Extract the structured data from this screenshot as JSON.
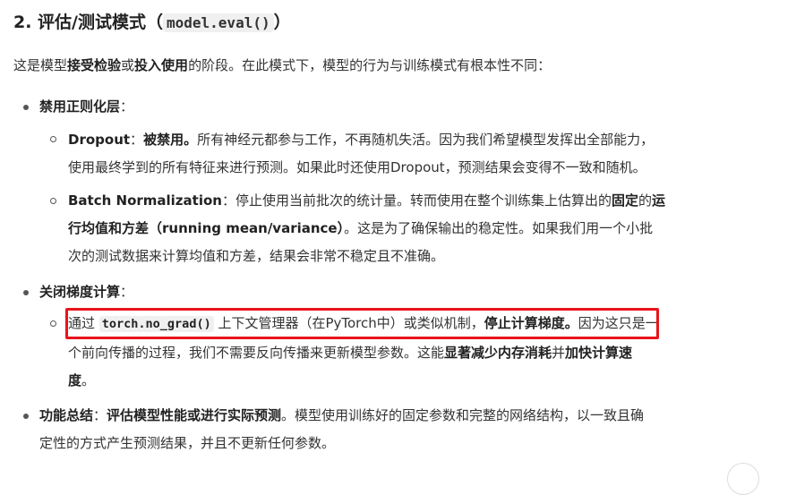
{
  "heading": {
    "prefix": "2. 评估/测试模式（",
    "code": "model.eval()",
    "suffix": "）"
  },
  "intro": {
    "t1": "这是模型",
    "b1": "接受检验",
    "t2": "或",
    "b2": "投入使用",
    "t3": "的阶段。在此模式下，模型的行为与训练模式有根本性不同："
  },
  "items": {
    "reg": {
      "label": "禁用正则化层",
      "colon": "："
    },
    "dropout": {
      "name": "Dropout",
      "t1": "：",
      "b1": "被禁用。",
      "t2": "所有神经元都参与工作，不再随机失活。因为我们希望模型发挥出全部能力，",
      "line2": "使用最终学到的所有特征来进行预测。如果此时还使用Dropout，预测结果会变得不一致和随机。"
    },
    "bn": {
      "name": "Batch Normalization",
      "t1": "：停止使用当前批次的统计量。转而使用在整个训练集上估算出的",
      "b1": "固定",
      "t2": "的",
      "b2": "运",
      "line2_b": "行均值和方差（running mean/variance）",
      "line2_t": "。这是为了确保输出的稳定性。如果我们用一个小批",
      "line3": "次的测试数据来计算均值和方差，结果会非常不稳定且不准确。"
    },
    "grad": {
      "label": "关闭梯度计算",
      "colon": "："
    },
    "nograd": {
      "t1": "通过 ",
      "code": "torch.no_grad()",
      "t2": " 上下文管理器（在PyTorch中）或类似机制，",
      "b1": "停止计算梯度。",
      "t3": "因为这只是一",
      "line2_t1": "个前向传播的过程，我们不需要反向传播来更新模型参数。这能",
      "line2_b1": "显著减少内存消耗",
      "line2_t2": "并",
      "line2_b2": "加快计算速",
      "line3_b": "度",
      "line3_t": "。"
    },
    "summary": {
      "label": "功能总结",
      "t1": "：",
      "b1": "评估模型性能或进行实际预测",
      "t2": "。模型使用训练好的固定参数和完整的网络结构，以一致且确",
      "line2": "定性的方式产生预测结果，并且不更新任何参数。"
    }
  },
  "colors": {
    "text": "#333333",
    "highlight_border": "#e8141b",
    "code_bg": "#f0f0f0"
  }
}
